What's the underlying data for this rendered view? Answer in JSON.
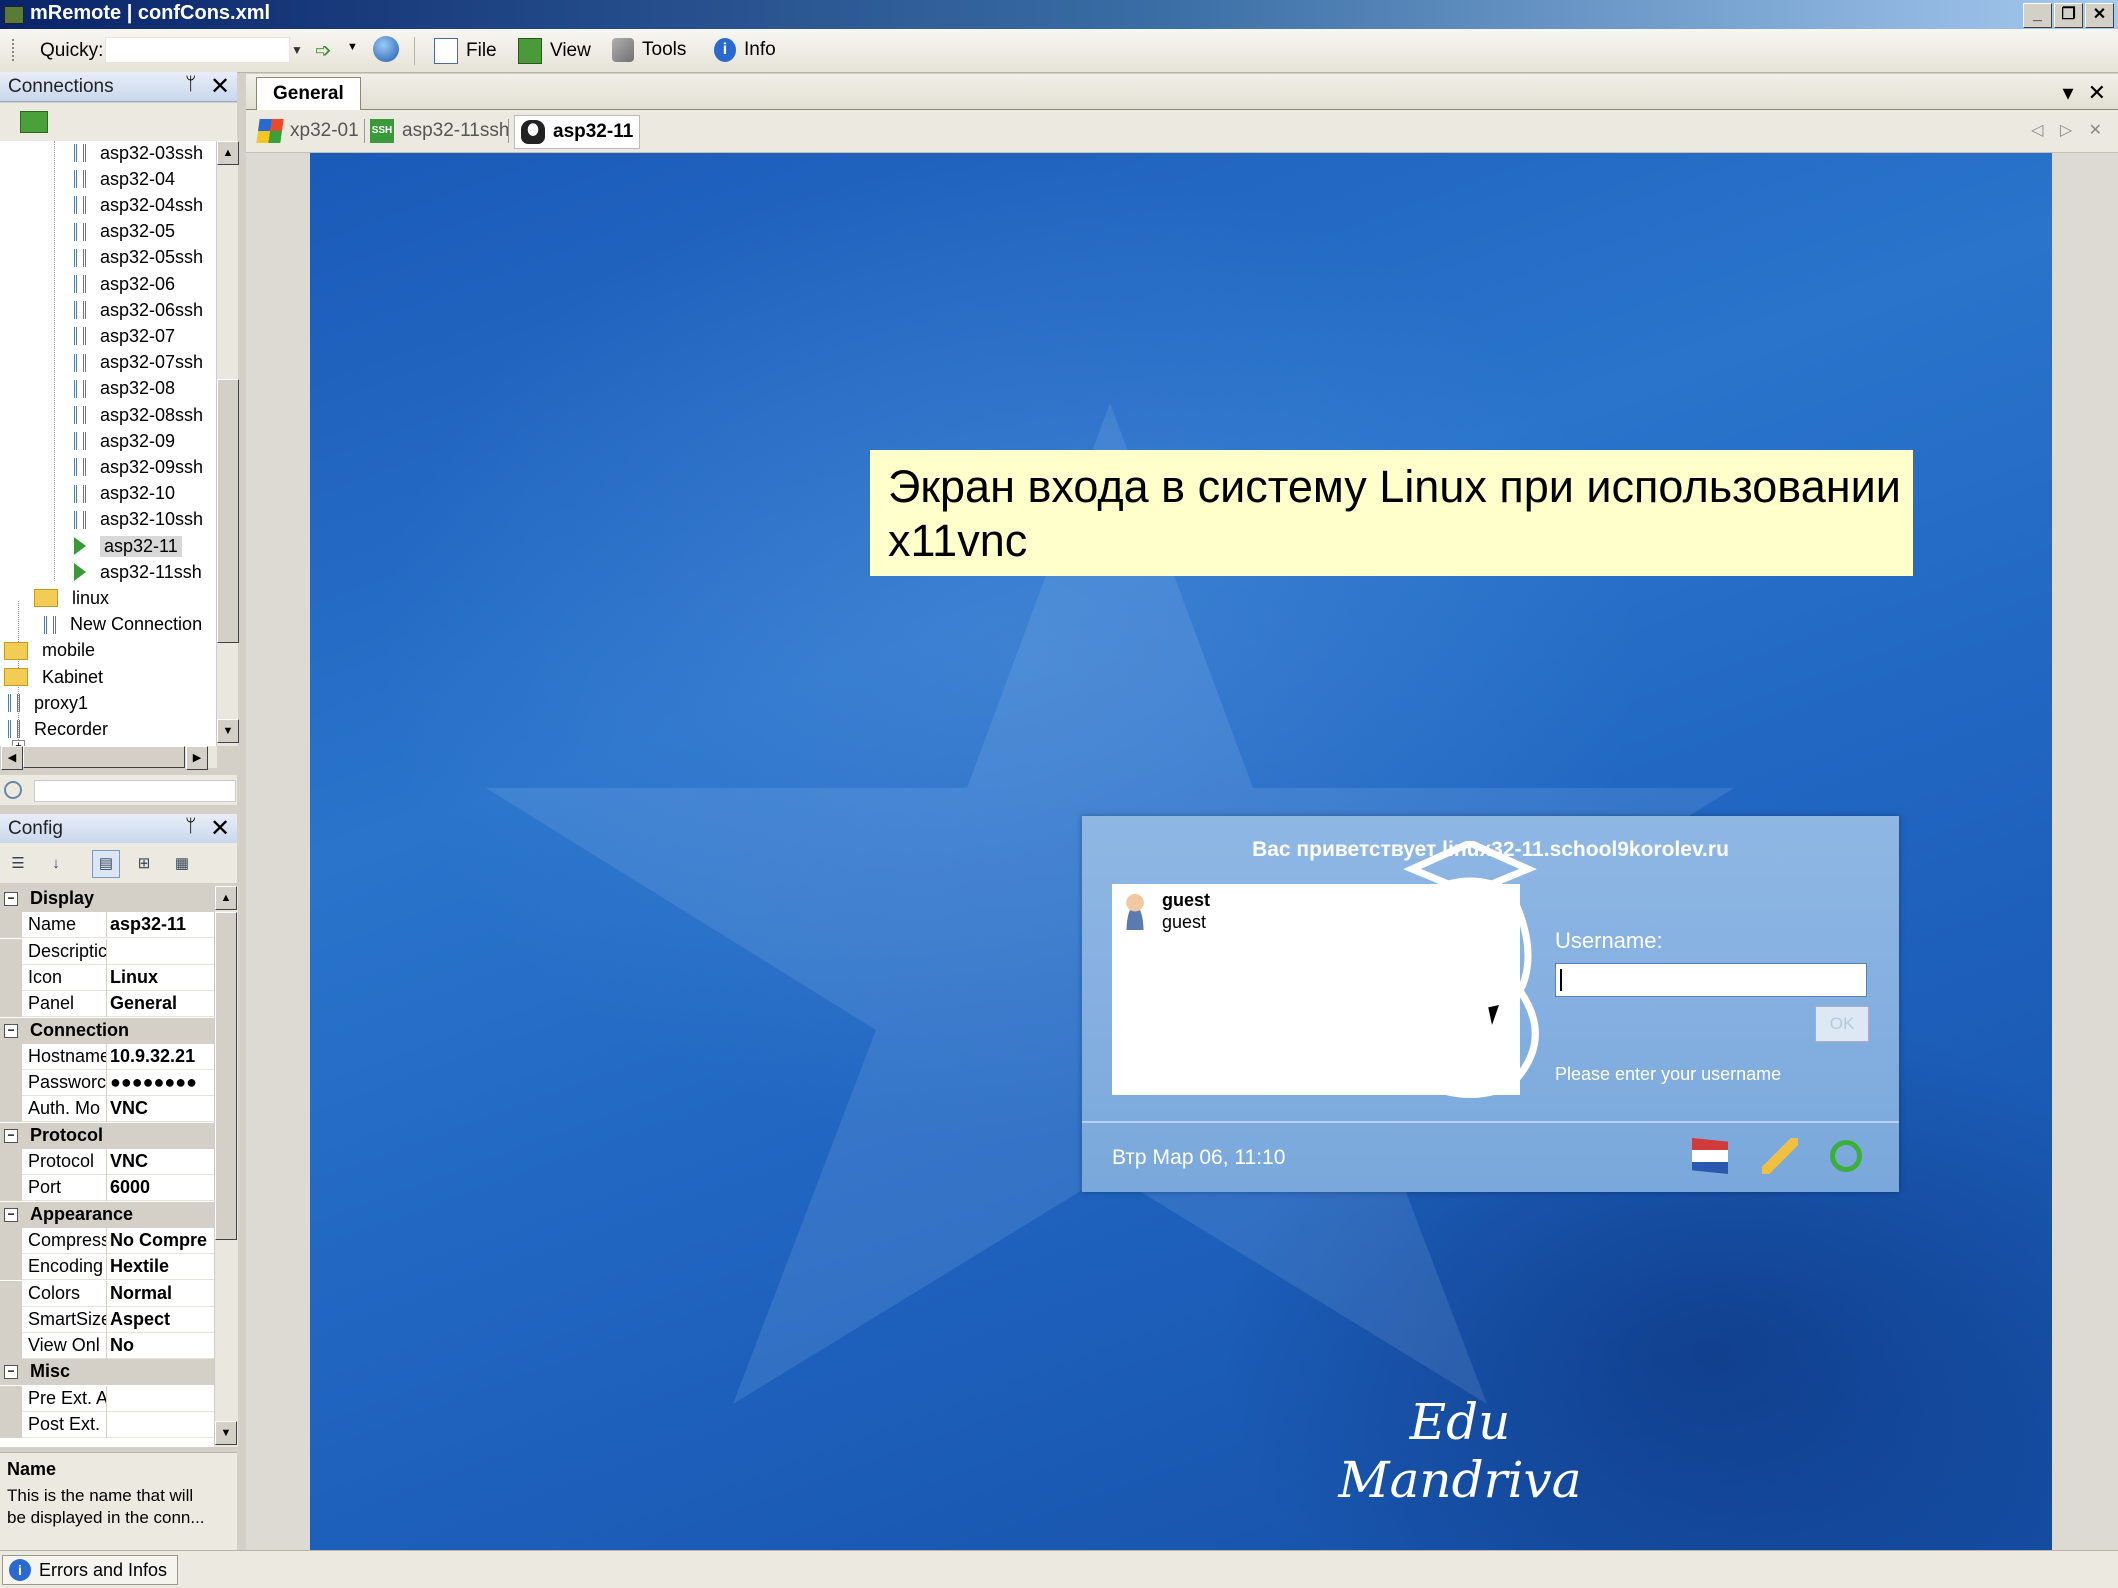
{
  "window": {
    "title": "mRemote | confCons.xml",
    "controls": [
      "_",
      "❐",
      "✕"
    ]
  },
  "toolbar": {
    "quicky_label": "Quicky:",
    "quicky_value": "",
    "menus": [
      "File",
      "View",
      "Tools",
      "Info"
    ]
  },
  "connections_panel": {
    "title": "Connections",
    "pin": "ᛘ",
    "close": "✕",
    "items": [
      {
        "label": "asp32-03ssh",
        "icon": "vnc-icon"
      },
      {
        "label": "asp32-04",
        "icon": "vnc-icon"
      },
      {
        "label": "asp32-04ssh",
        "icon": "vnc-icon"
      },
      {
        "label": "asp32-05",
        "icon": "vnc-icon"
      },
      {
        "label": "asp32-05ssh",
        "icon": "vnc-icon"
      },
      {
        "label": "asp32-06",
        "icon": "vnc-icon"
      },
      {
        "label": "asp32-06ssh",
        "icon": "vnc-icon"
      },
      {
        "label": "asp32-07",
        "icon": "vnc-icon"
      },
      {
        "label": "asp32-07ssh",
        "icon": "vnc-icon"
      },
      {
        "label": "asp32-08",
        "icon": "vnc-icon"
      },
      {
        "label": "asp32-08ssh",
        "icon": "vnc-icon"
      },
      {
        "label": "asp32-09",
        "icon": "vnc-icon"
      },
      {
        "label": "asp32-09ssh",
        "icon": "vnc-icon"
      },
      {
        "label": "asp32-10",
        "icon": "vnc-icon"
      },
      {
        "label": "asp32-10ssh",
        "icon": "vnc-icon"
      },
      {
        "label": "asp32-11",
        "icon": "play-icon",
        "selected": true
      },
      {
        "label": "asp32-11ssh",
        "icon": "play-icon"
      },
      {
        "label": "linux",
        "icon": "folder-icon"
      },
      {
        "label": "New Connection",
        "icon": "vnc-icon"
      },
      {
        "label": "mobile",
        "icon": "folder-icon"
      },
      {
        "label": "Kabinet",
        "icon": "folder-icon"
      },
      {
        "label": "proxy1",
        "icon": "vnc-icon"
      },
      {
        "label": "Recorder",
        "icon": "vnc-icon"
      }
    ]
  },
  "config_panel": {
    "title": "Config",
    "pin": "ᛘ",
    "close": "✕",
    "categories": [
      {
        "name": "Display",
        "props": [
          {
            "key": "Name",
            "value": "asp32-11"
          },
          {
            "key": "Descriptic",
            "value": ""
          },
          {
            "key": "Icon",
            "value": "Linux"
          },
          {
            "key": "Panel",
            "value": "General"
          }
        ]
      },
      {
        "name": "Connection",
        "props": [
          {
            "key": "Hostname",
            "value": "10.9.32.21"
          },
          {
            "key": "Passworc",
            "value": "●●●●●●●●"
          },
          {
            "key": "Auth. Mo",
            "value": "VNC"
          }
        ]
      },
      {
        "name": "Protocol",
        "props": [
          {
            "key": "Protocol",
            "value": "VNC"
          },
          {
            "key": "Port",
            "value": "6000"
          }
        ]
      },
      {
        "name": "Appearance",
        "props": [
          {
            "key": "Compress",
            "value": "No Compre"
          },
          {
            "key": "Encoding",
            "value": "Hextile"
          },
          {
            "key": "Colors",
            "value": "Normal"
          },
          {
            "key": "SmartSize",
            "value": "Aspect"
          },
          {
            "key": "View Onl",
            "value": "No"
          }
        ]
      },
      {
        "name": "Misc",
        "props": [
          {
            "key": "Pre Ext. A",
            "value": ""
          },
          {
            "key": "Post Ext.",
            "value": ""
          }
        ]
      }
    ],
    "help_title": "Name",
    "help_text": "This is the name that will be displayed in the conn..."
  },
  "main": {
    "panel_tab": "General",
    "connection_tabs": [
      {
        "label": "xp32-01",
        "icon": "windows-icon"
      },
      {
        "label": "asp32-11ssh",
        "icon": "ssh-icon",
        "icon_text": "SSH"
      },
      {
        "label": "asp32-11",
        "icon": "linux-icon",
        "active": true
      }
    ]
  },
  "remote": {
    "annotation": "Экран входа в систему Linux при использовании x11vnc",
    "greeting": "Вас приветствует linux32-11.school9korolev.ru",
    "user_name": "guest",
    "user_login": "guest",
    "username_label": "Username:",
    "ok_label": "OK",
    "hint": "Please enter your username",
    "clock": "Втр Мар 06, 11:10",
    "brand": "Edu Mandriva"
  },
  "statusbar": {
    "tab": "Errors and Infos"
  },
  "colors": {
    "desktop": "#1e62be",
    "annotation_bg": "#ffffcc",
    "login_bg": "#8fb7e4"
  }
}
